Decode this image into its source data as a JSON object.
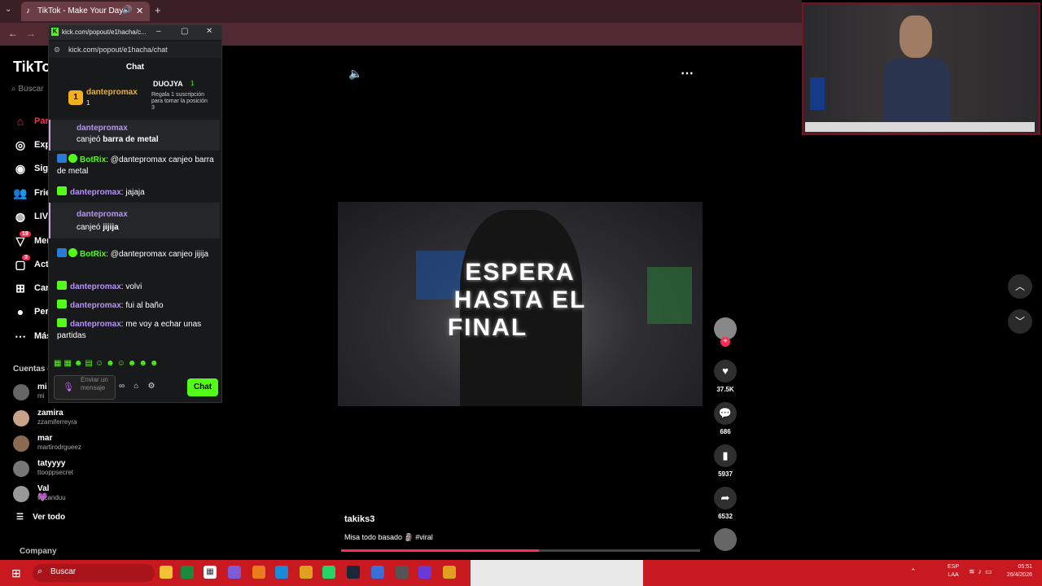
{
  "browser": {
    "tab_title": "TikTok - Make Your Day",
    "tab_favicon": "tiktok-icon",
    "new_tab": "+"
  },
  "kick": {
    "window_title": "kick.com/popout/e1hacha/c...",
    "url": "kick.com/popout/e1hacha/chat",
    "chat_header": "Chat",
    "leaderboard": {
      "first_rank": "1",
      "first_user": "dantepromax",
      "first_count": "1",
      "second_user": "DUOJYA",
      "second_count": "1",
      "third_text": "Regala 1 suscripción para tomar la posición 3"
    },
    "messages": [
      {
        "type": "redeem",
        "user": "dantepromax",
        "action": "canjeó",
        "item": "barra de metal"
      },
      {
        "type": "bot",
        "user": "BotRix",
        "text": "@dantepromax canjeo barra de metal"
      },
      {
        "type": "chat",
        "user": "dantepromax",
        "text": "jajaja"
      },
      {
        "type": "redeem",
        "user": "dantepromax",
        "action": "canjeó",
        "item": "jijija"
      },
      {
        "type": "bot",
        "user": "BotRix",
        "text": "@dantepromax canjeo jijija"
      },
      {
        "type": "chat",
        "user": "dantepromax",
        "text": "volvi"
      },
      {
        "type": "chat",
        "user": "dantepromax",
        "text": "fui al baño"
      },
      {
        "type": "chat",
        "user": "dantepromax",
        "text": "me voy a echar unas partidas"
      }
    ],
    "input_placeholder": "Enviar un mensaje",
    "send_label": "Chat"
  },
  "tiktok": {
    "logo": "TikTok",
    "search_placeholder": "Buscar",
    "nav": [
      {
        "label": "Para ti",
        "icon": "home-icon"
      },
      {
        "label": "Explorar",
        "icon": "compass-icon"
      },
      {
        "label": "Siguiendo",
        "icon": "following-icon"
      },
      {
        "label": "Friends",
        "icon": "friends-icon"
      },
      {
        "label": "LIVE",
        "icon": "live-icon"
      },
      {
        "label": "Mensajes",
        "icon": "messages-icon",
        "badge": "19"
      },
      {
        "label": "Actividad",
        "icon": "activity-icon",
        "badge": "3"
      },
      {
        "label": "Cargar",
        "icon": "upload-icon"
      },
      {
        "label": "Perfil",
        "icon": "profile-icon"
      },
      {
        "label": "Más",
        "icon": "more-icon"
      }
    ],
    "following_title": "Cuentas que sigues",
    "accounts": [
      {
        "name": "mi",
        "username": "mi"
      },
      {
        "name": "zamira",
        "username": "zzamiferreyra"
      },
      {
        "name": "mar",
        "username": "martirodrgueez"
      },
      {
        "name": "tatyyyy",
        "username": "ttooppsecret"
      },
      {
        "name": "Val💜",
        "username": "vgcanduu"
      }
    ],
    "see_all": "Ver todo",
    "company": "Company"
  },
  "video": {
    "caption_lines": [
      "ESPERA",
      "HASTA EL",
      "FINAL"
    ],
    "author": "takiks3",
    "description": "Misa todo basado 🗿 #viral",
    "progress": 0.55,
    "likes": "37.5K",
    "comments": "686",
    "saves": "5937",
    "shares": "6532"
  },
  "taskbar": {
    "search": "Buscar",
    "lang_top": "ESP",
    "lang_bottom": "LAA",
    "time": "05:51",
    "date": "26/4/2026"
  },
  "colors": {
    "tiktok_red": "#fe2c55",
    "kick_green": "#53fc18",
    "taskbar": "#c81820"
  }
}
